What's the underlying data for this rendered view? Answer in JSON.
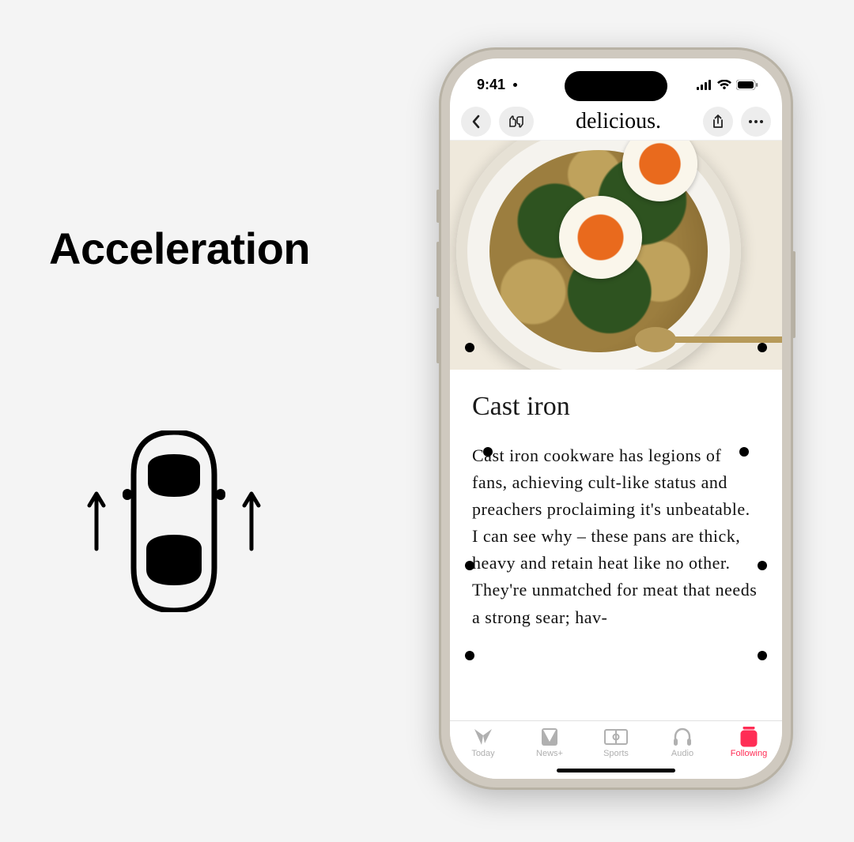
{
  "left": {
    "heading": "Acceleration"
  },
  "phone": {
    "status": {
      "time": "9:41"
    },
    "nav": {
      "title": "delicious."
    },
    "article": {
      "title": "Cast iron",
      "body": "Cast iron cookware has legions of fans, achieving cult-like status and preachers proclaiming it's unbeatable. I can see why – these pans are thick, heavy and retain heat like no other. They're unmatched for meat that needs a strong sear; hav-"
    },
    "tabs": [
      {
        "label": "Today"
      },
      {
        "label": "News+"
      },
      {
        "label": "Sports"
      },
      {
        "label": "Audio"
      },
      {
        "label": "Following"
      }
    ]
  }
}
